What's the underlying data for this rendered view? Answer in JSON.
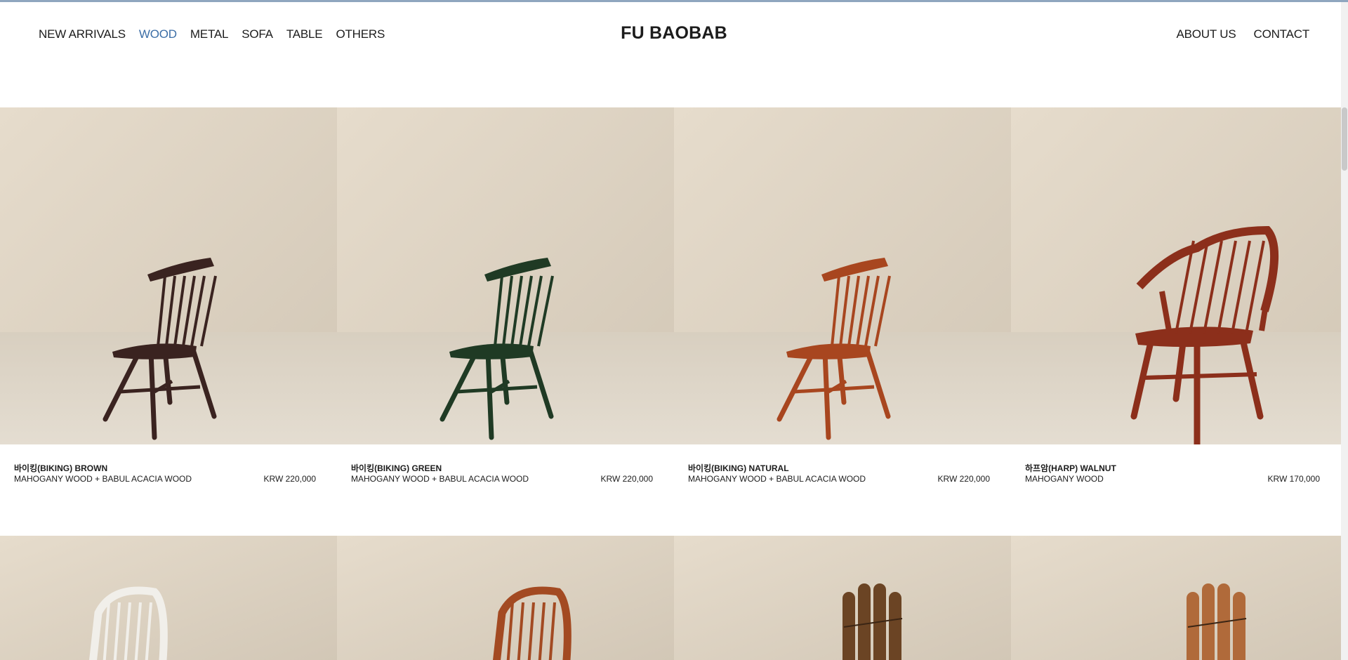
{
  "brand": "FU BAOBAB",
  "nav_left": [
    {
      "label": "NEW ARRIVALS",
      "active": false
    },
    {
      "label": "WOOD",
      "active": true
    },
    {
      "label": "METAL",
      "active": false
    },
    {
      "label": "SOFA",
      "active": false
    },
    {
      "label": "TABLE",
      "active": false
    },
    {
      "label": "OTHERS",
      "active": false
    }
  ],
  "nav_right": [
    {
      "label": "ABOUT US"
    },
    {
      "label": "CONTACT"
    }
  ],
  "colors": {
    "accent": "#3c6ea6",
    "text": "#1c1c1c",
    "backdrop": "#ddd3c4"
  },
  "products": [
    {
      "name": "바이킹(BIKING) BROWN",
      "material": "MAHOGANY WOOD + BABUL ACACIA WOOD",
      "price": "KRW 220,000",
      "chair_color": "#3a2320",
      "chair_style": "windsor-side"
    },
    {
      "name": "바이킹(BIKING) GREEN",
      "material": "MAHOGANY WOOD + BABUL ACACIA WOOD",
      "price": "KRW 220,000",
      "chair_color": "#1f3a24",
      "chair_style": "windsor-side"
    },
    {
      "name": "바이킹(BIKING) NATURAL",
      "material": "MAHOGANY WOOD + BABUL ACACIA WOOD",
      "price": "KRW 220,000",
      "chair_color": "#a8461f",
      "chair_style": "windsor-side"
    },
    {
      "name": "하프암(HARP) WALNUT",
      "material": "MAHOGANY WOOD",
      "price": "KRW 170,000",
      "chair_color": "#8c2f1b",
      "chair_style": "windsor-arm"
    }
  ],
  "products_row2": [
    {
      "chair_color": "#f1efea",
      "chair_style": "hoop-back"
    },
    {
      "chair_color": "#a34a22",
      "chair_style": "hoop-back"
    },
    {
      "chair_color": "#6b4424",
      "chair_style": "adirondack"
    },
    {
      "chair_color": "#b06a3a",
      "chair_style": "adirondack"
    }
  ]
}
